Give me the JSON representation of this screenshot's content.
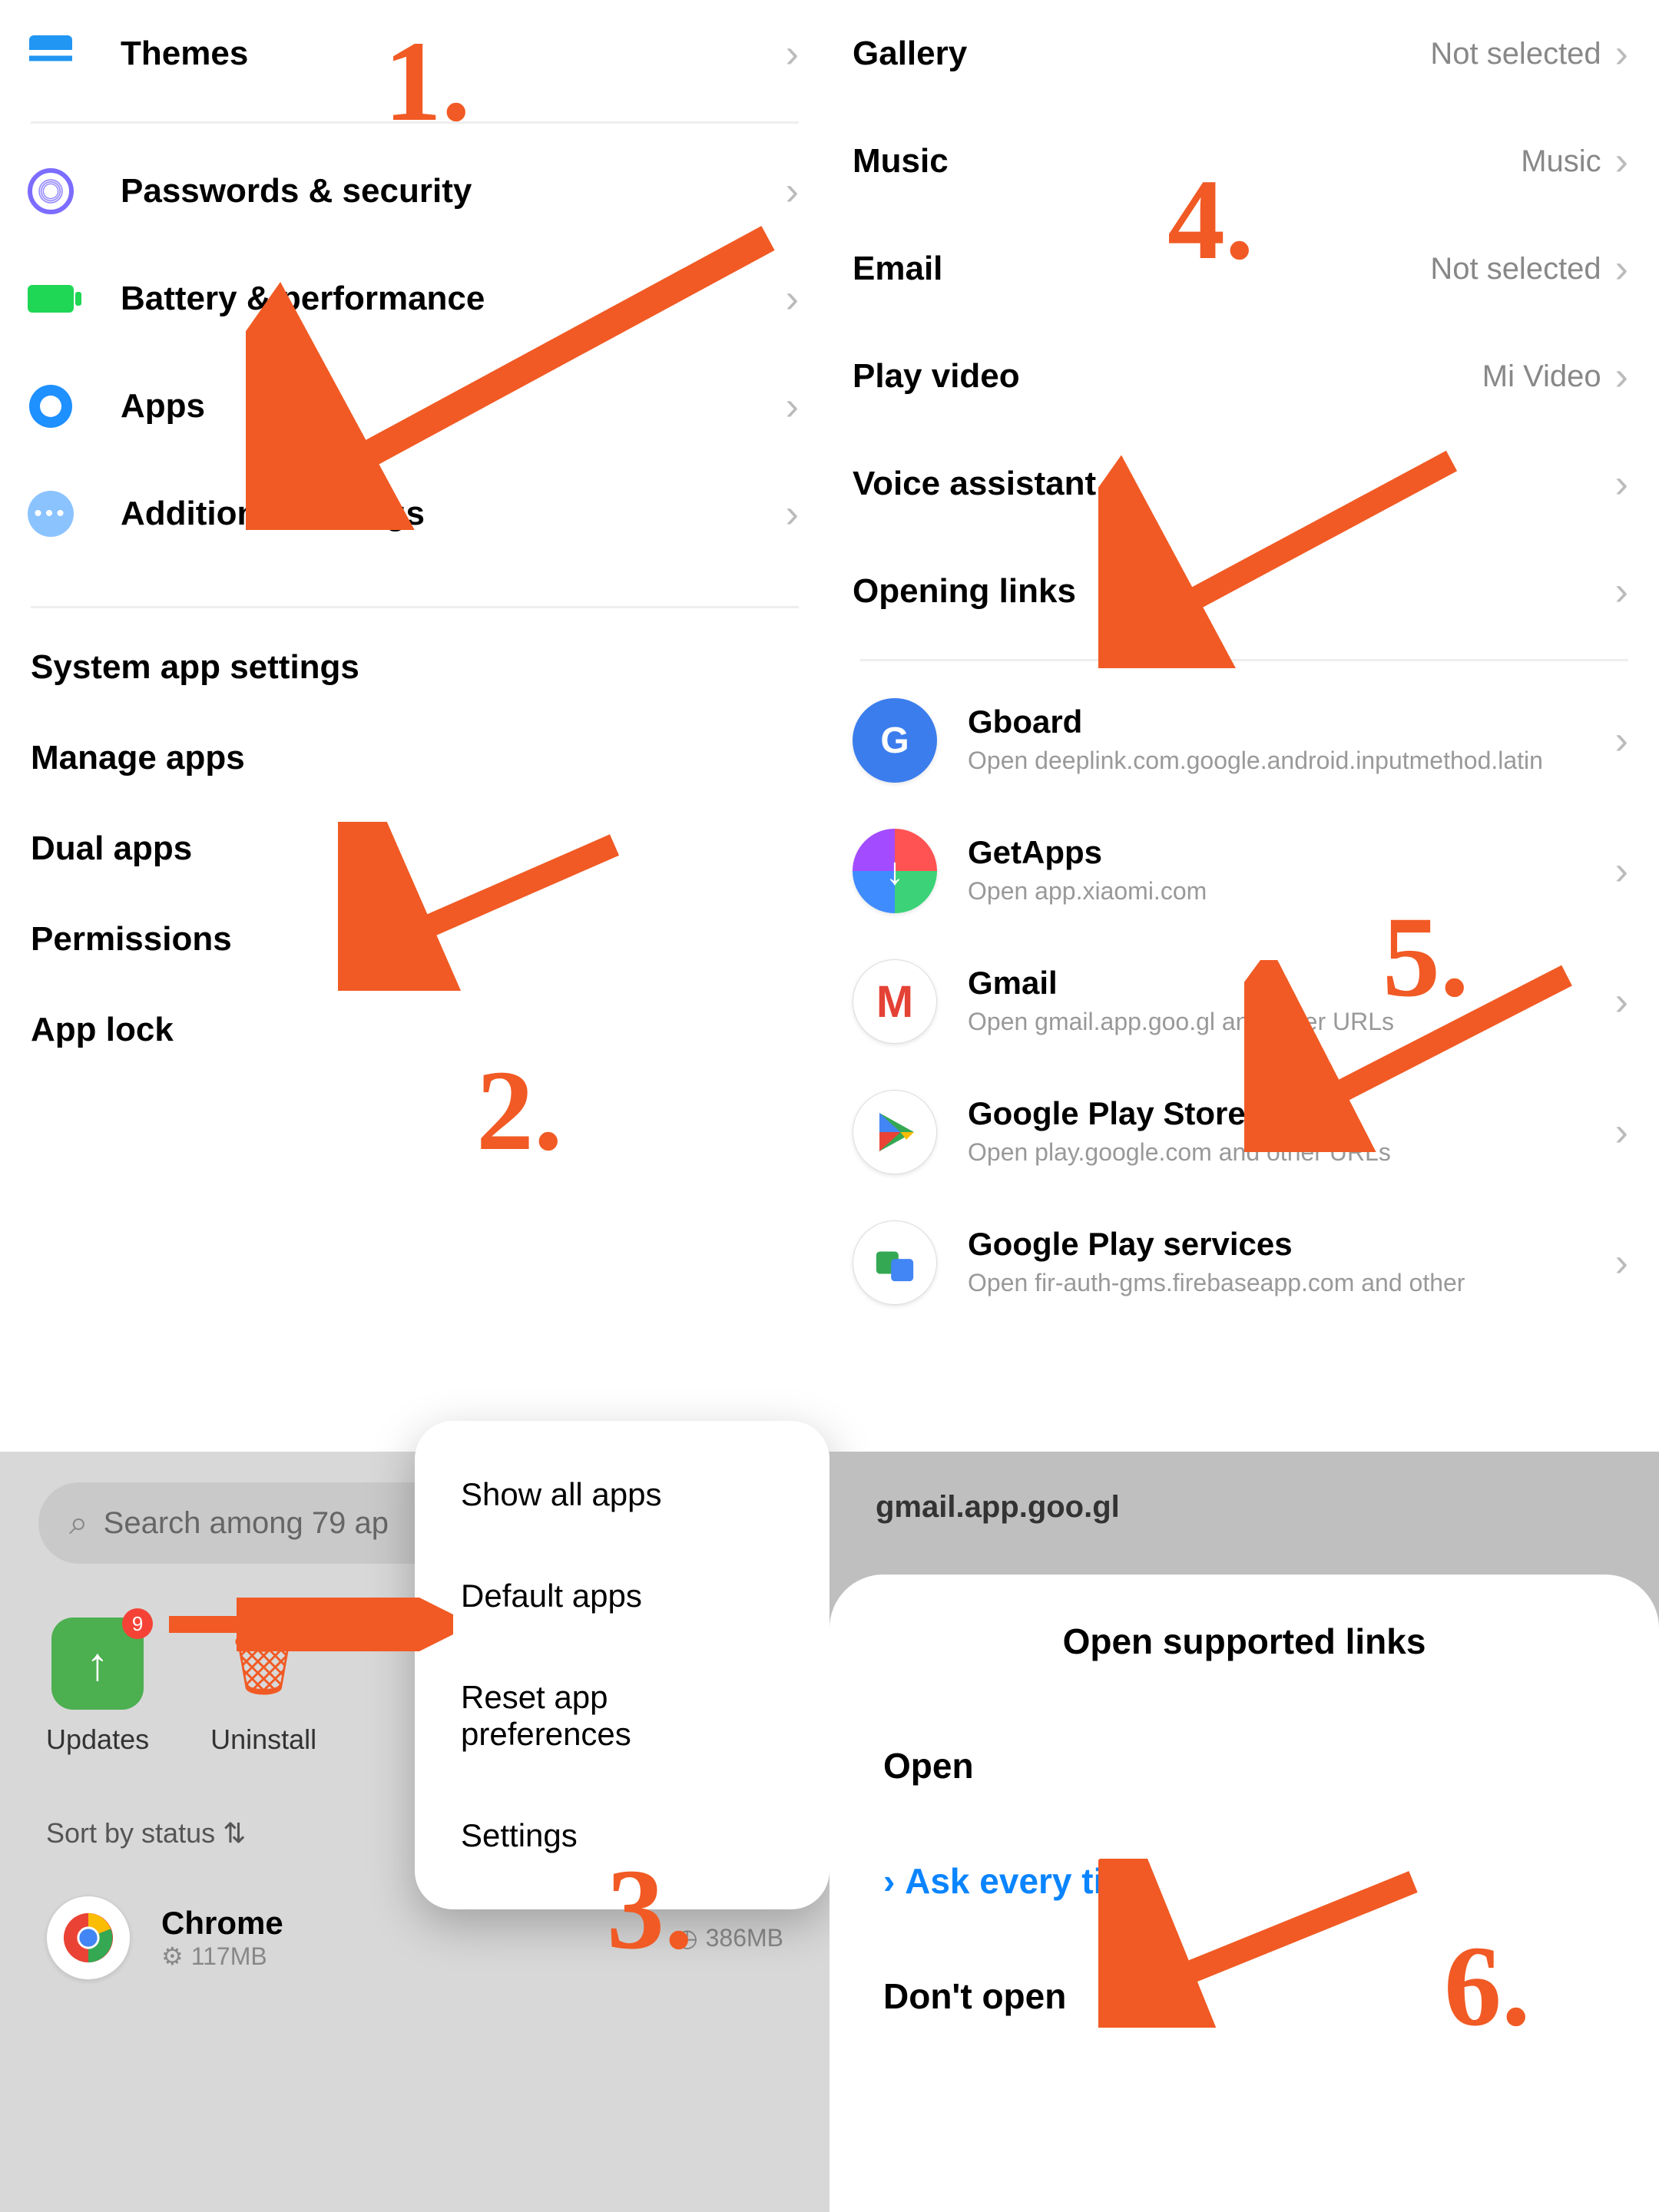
{
  "steps": {
    "s1": "1.",
    "s2": "2.",
    "s3": "3.",
    "s4": "4.",
    "s5": "5.",
    "s6": "6."
  },
  "settings_left": {
    "themes": "Themes",
    "passwords": "Passwords & security",
    "battery": "Battery & performance",
    "apps": "Apps",
    "additional": "Additional settings"
  },
  "apps_sub": {
    "system_app": "System app settings",
    "manage": "Manage apps",
    "dual": "Dual apps",
    "permissions": "Permissions",
    "applock": "App lock"
  },
  "defaults": {
    "gallery": {
      "label": "Gallery",
      "value": "Not selected"
    },
    "music": {
      "label": "Music",
      "value": "Music"
    },
    "email": {
      "label": "Email",
      "value": "Not selected"
    },
    "video": {
      "label": "Play video",
      "value": "Mi Video"
    },
    "voice": {
      "label": "Voice assistant",
      "value": ""
    },
    "links": {
      "label": "Opening links",
      "value": ""
    }
  },
  "opening_links": {
    "gboard": {
      "title": "Gboard",
      "sub": "Open deeplink.com.google.android.inputmethod.latin"
    },
    "getapps": {
      "title": "GetApps",
      "sub": "Open app.xiaomi.com"
    },
    "gmail": {
      "title": "Gmail",
      "sub": "Open gmail.app.goo.gl and other URLs"
    },
    "playstore": {
      "title": "Google Play Store",
      "sub": "Open play.google.com and other URLs"
    },
    "playservices": {
      "title": "Google Play services",
      "sub": "Open fir-auth-gms.firebaseapp.com and other"
    }
  },
  "panel3": {
    "search_placeholder": "Search among 79 ap",
    "updates": "Updates",
    "updates_badge": "9",
    "uninstall": "Uninstall",
    "sort": "Sort by status",
    "chrome": {
      "name": "Chrome",
      "storage": "117MB",
      "data": "386MB"
    },
    "menu": {
      "show_all": "Show all apps",
      "default": "Default apps",
      "reset": "Reset app preferences",
      "settings": "Settings"
    }
  },
  "panel6": {
    "domain": "gmail.app.goo.gl",
    "title": "Open supported links",
    "open": "Open",
    "ask": "Ask every time",
    "dont": "Don't open"
  }
}
